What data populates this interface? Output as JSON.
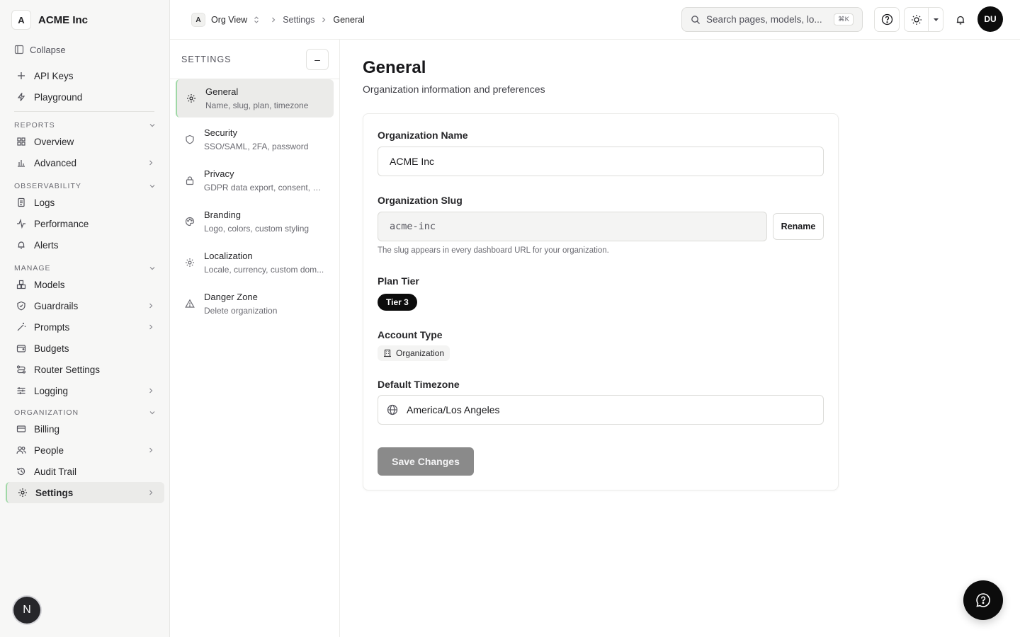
{
  "app": {
    "org_initial": "A",
    "org_name": "ACME Inc",
    "collapse_label": "Collapse"
  },
  "sidebar": {
    "top_items": [
      {
        "label": "API Keys",
        "icon": "plus-icon"
      },
      {
        "label": "Playground",
        "icon": "bolt-icon"
      }
    ],
    "sections": [
      {
        "title": "REPORTS",
        "items": [
          {
            "label": "Overview",
            "icon": "grid-icon",
            "has_children": false
          },
          {
            "label": "Advanced",
            "icon": "bar-chart-icon",
            "has_children": true
          }
        ]
      },
      {
        "title": "OBSERVABILITY",
        "items": [
          {
            "label": "Logs",
            "icon": "scroll-icon",
            "has_children": false
          },
          {
            "label": "Performance",
            "icon": "activity-icon",
            "has_children": false
          },
          {
            "label": "Alerts",
            "icon": "bell-icon",
            "has_children": false
          }
        ]
      },
      {
        "title": "MANAGE",
        "items": [
          {
            "label": "Models",
            "icon": "boxes-icon",
            "has_children": false
          },
          {
            "label": "Guardrails",
            "icon": "shield-icon",
            "has_children": true
          },
          {
            "label": "Prompts",
            "icon": "wand-icon",
            "has_children": true
          },
          {
            "label": "Budgets",
            "icon": "wallet-icon",
            "has_children": false
          },
          {
            "label": "Router Settings",
            "icon": "route-icon",
            "has_children": false
          },
          {
            "label": "Logging",
            "icon": "sliders-icon",
            "has_children": true
          }
        ]
      },
      {
        "title": "ORGANIZATION",
        "items": [
          {
            "label": "Billing",
            "icon": "card-icon",
            "has_children": false
          },
          {
            "label": "People",
            "icon": "users-icon",
            "has_children": true
          },
          {
            "label": "Audit Trail",
            "icon": "history-icon",
            "has_children": false
          },
          {
            "label": "Settings",
            "icon": "gear-icon",
            "has_children": true,
            "active": true
          }
        ]
      }
    ],
    "bottom_badge": "N"
  },
  "header": {
    "breadcrumb": {
      "org_badge": "A",
      "org_view": "Org View",
      "settings": "Settings",
      "current": "General"
    },
    "search": {
      "placeholder": "Search pages, models, lo...",
      "shortcut": "⌘K"
    },
    "user_initials": "DU"
  },
  "settings_nav": {
    "title": "SETTINGS",
    "collapse_symbol": "–",
    "items": [
      {
        "title": "General",
        "subtitle": "Name, slug, plan, timezone",
        "icon": "gear-icon",
        "active": true
      },
      {
        "title": "Security",
        "subtitle": "SSO/SAML, 2FA, password",
        "icon": "shield-icon"
      },
      {
        "title": "Privacy",
        "subtitle": "GDPR data export, consent, er...",
        "icon": "lock-icon"
      },
      {
        "title": "Branding",
        "subtitle": "Logo, colors, custom styling",
        "icon": "palette-icon"
      },
      {
        "title": "Localization",
        "subtitle": "Locale, currency, custom dom...",
        "icon": "gear-icon"
      },
      {
        "title": "Danger Zone",
        "subtitle": "Delete organization",
        "icon": "warning-icon"
      }
    ]
  },
  "main": {
    "title": "General",
    "subtitle": "Organization information and preferences",
    "form": {
      "org_name_label": "Organization Name",
      "org_name_value": "ACME Inc",
      "slug_label": "Organization Slug",
      "slug_value": "acme-inc",
      "rename_label": "Rename",
      "slug_hint": "The slug appears in every dashboard URL for your organization.",
      "plan_label": "Plan Tier",
      "plan_value": "Tier 3",
      "account_label": "Account Type",
      "account_value": "Organization",
      "timezone_label": "Default Timezone",
      "timezone_value": "America/Los Angeles",
      "save_label": "Save Changes"
    }
  },
  "colors": {
    "accent_active_border": "#9fd8a6",
    "primary_dark": "#0c0c0c",
    "disabled_button": "#8a8a8a",
    "sidebar_bg": "#f7f7f6"
  }
}
